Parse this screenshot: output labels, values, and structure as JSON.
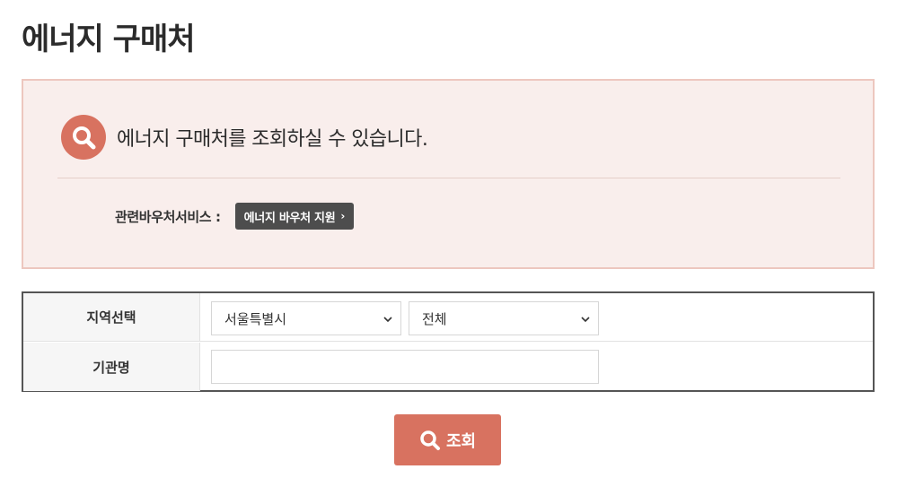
{
  "page": {
    "title": "에너지 구매처"
  },
  "info": {
    "heading": "에너지 구매처를 조회하실 수 있습니다.",
    "related_label": "관련바우처서비스 :",
    "voucher_button_label": "에너지 바우처 지원",
    "voucher_button_chevron": "›"
  },
  "form": {
    "region_label": "지역선택",
    "region_value": "서울특별시",
    "district_value": "전체",
    "org_label": "기관명",
    "org_value": ""
  },
  "submit": {
    "label": "조회"
  },
  "colors": {
    "accent": "#d87260",
    "info_bg": "#f9eeec",
    "info_border": "#edc7bf",
    "dark_button": "#4d4d4d"
  }
}
